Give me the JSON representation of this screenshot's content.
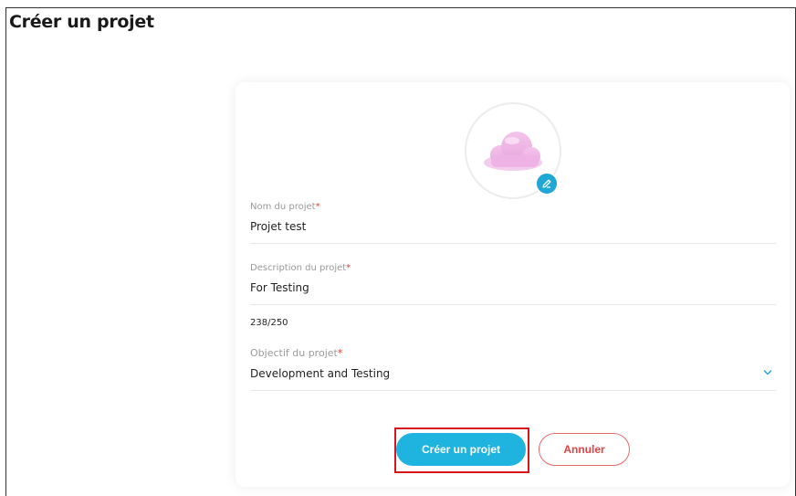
{
  "page": {
    "title": "Créer un projet"
  },
  "avatar": {
    "icon": "cloud-icon",
    "edit_icon": "pencil-icon"
  },
  "form": {
    "name": {
      "label": "Nom du projet",
      "required_mark": "*",
      "value": "Projet test"
    },
    "description": {
      "label": "Description du projet",
      "required_mark": "*",
      "value": "For Testing",
      "counter": "238/250"
    },
    "objective": {
      "label": "Objectif du projet",
      "required_mark": "*",
      "value": "Development and Testing"
    }
  },
  "actions": {
    "submit_label": "Créer un projet",
    "cancel_label": "Annuler"
  },
  "colors": {
    "primary": "#1fb4e0",
    "cancel": "#e04545",
    "highlight": "#d8141c",
    "badge": "#1fa7d6"
  }
}
